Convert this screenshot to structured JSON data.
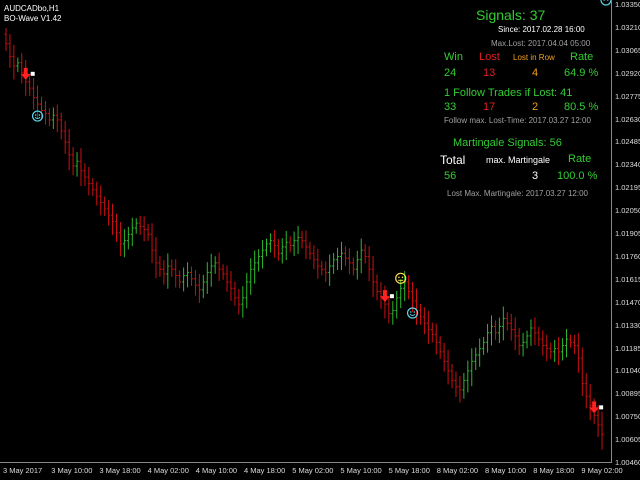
{
  "window": {
    "symbol": "AUDCADbo,H1",
    "indicator": "BO-Wave V1.42"
  },
  "colors": {
    "background": "#000000",
    "bull_bar": "#2db82d",
    "bear_bar": "#cc1010",
    "arrow": "#ff2020",
    "smiley_win": "#5fd3e8",
    "smiley_wait": "#ffe14a",
    "panel_green": "#33cc33",
    "panel_red": "#e02020",
    "panel_orange": "#f0a020",
    "panel_grey": "#a0a0a0",
    "panel_white": "#ffffff"
  },
  "price_axis": [
    "1.03350",
    "1.03210",
    "1.03065",
    "1.02920",
    "1.02775",
    "1.02630",
    "1.02485",
    "1.02340",
    "1.02195",
    "1.02050",
    "1.01905",
    "1.01760",
    "1.01615",
    "1.01470",
    "1.01330",
    "1.01185",
    "1.01040",
    "1.00895",
    "1.00750",
    "1.00605",
    "1.00460"
  ],
  "time_axis": [
    "3 May 2017",
    "3 May 10:00",
    "3 May 18:00",
    "4 May 02:00",
    "4 May 10:00",
    "4 May 18:00",
    "5 May 02:00",
    "5 May 10:00",
    "5 May 18:00",
    "8 May 02:00",
    "8 May 10:00",
    "8 May 18:00",
    "9 May 02:00"
  ],
  "panel": {
    "signals_label": "Signals: 37",
    "since": "Since: 2017.02.28 16:00",
    "max_lost": "Max.Lost: 2017.04.04 05:00",
    "headers": {
      "win": "Win",
      "lost": "Lost",
      "lost_in_row": "Lost in Row",
      "rate": "Rate"
    },
    "row1": {
      "win": "24",
      "lost": "13",
      "lost_in_row": "4",
      "rate": "64.9 %"
    },
    "follow_title": "1 Follow Trades if Lost: 41",
    "row2": {
      "win": "33",
      "lost": "17",
      "lost_in_row": "2",
      "rate": "80.5 %"
    },
    "follow_max": "Follow max. Lost-Time:  2017.03.27 12:00",
    "martingale_title": "Martingale Signals: 56",
    "mart_headers": {
      "total": "Total",
      "max": "max. Martingale",
      "rate": "Rate"
    },
    "row3": {
      "total": "56",
      "max": "3",
      "rate": "100.0 %"
    },
    "lost_max_martingale": "Lost Max. Martingale:  2017.03.27 12:00"
  },
  "chart_data": {
    "type": "bar",
    "title": "AUDCADbo,H1",
    "ylim": [
      1.0046,
      1.0335
    ],
    "x_ticks": [
      "3 May 2017",
      "3 May 10:00",
      "3 May 18:00",
      "4 May 02:00",
      "4 May 10:00",
      "4 May 18:00",
      "5 May 02:00",
      "5 May 10:00",
      "5 May 18:00",
      "8 May 02:00",
      "8 May 10:00",
      "8 May 18:00",
      "9 May 02:00"
    ],
    "series": [
      {
        "name": "AUDCADbo,H1",
        "closes": [
          1.031,
          1.0302,
          1.0296,
          1.0298,
          1.0292,
          1.0286,
          1.0282,
          1.0276,
          1.0272,
          1.0268,
          1.0266,
          1.0262,
          1.0265,
          1.0262,
          1.0255,
          1.0248,
          1.024,
          1.0233,
          1.0236,
          1.023,
          1.0226,
          1.0222,
          1.0218,
          1.0214,
          1.021,
          1.0206,
          1.0202,
          1.0198,
          1.0191,
          1.0184,
          1.0186,
          1.019,
          1.0194,
          1.0197,
          1.0195,
          1.0193,
          1.019,
          1.018,
          1.0172,
          1.0168,
          1.0165,
          1.017,
          1.0168,
          1.0164,
          1.016,
          1.0164,
          1.0166,
          1.0162,
          1.0158,
          1.0155,
          1.016,
          1.0166,
          1.017,
          1.0172,
          1.0168,
          1.0165,
          1.016,
          1.0156,
          1.015,
          1.0146,
          1.015,
          1.016,
          1.0168,
          1.0172,
          1.0176,
          1.018,
          1.0184,
          1.0186,
          1.0183,
          1.0178,
          1.0182,
          1.0185,
          1.0183,
          1.0186,
          1.0188,
          1.0186,
          1.0182,
          1.0178,
          1.0174,
          1.017,
          1.0168,
          1.0166,
          1.017,
          1.0174,
          1.0176,
          1.0178,
          1.0175,
          1.0172,
          1.0168,
          1.0174,
          1.018,
          1.0176,
          1.0168,
          1.016,
          1.0154,
          1.015,
          1.0146,
          1.014,
          1.0142,
          1.015,
          1.0156,
          1.016,
          1.0154,
          1.0148,
          1.0142,
          1.0138,
          1.0134,
          1.013,
          1.0127,
          1.0122,
          1.0116,
          1.011,
          1.0104,
          1.0098,
          1.0094,
          1.0092,
          1.0098,
          1.0104,
          1.011,
          1.0114,
          1.0118,
          1.0122,
          1.0128,
          1.0132,
          1.0128,
          1.0132,
          1.0137,
          1.0134,
          1.013,
          1.0126,
          1.012,
          1.0122,
          1.0126,
          1.0131,
          1.0128,
          1.0124,
          1.012,
          1.0118,
          1.0116,
          1.0118,
          1.0116,
          1.012,
          1.0124,
          1.0122,
          1.012,
          1.0112,
          1.0096,
          1.0088,
          1.0082,
          1.0076,
          1.007,
          1.0064
        ]
      }
    ],
    "signals": [
      {
        "type": "down-arrow",
        "bar_index": 5
      },
      {
        "type": "win-smiley",
        "bar_index": 8
      },
      {
        "type": "down-arrow",
        "bar_index": 96
      },
      {
        "type": "wait-smiley",
        "bar_index": 100
      },
      {
        "type": "win-smiley",
        "bar_index": 103
      },
      {
        "type": "down-arrow",
        "bar_index": 149
      },
      {
        "type": "win-smiley",
        "bar_index": 152
      }
    ]
  }
}
